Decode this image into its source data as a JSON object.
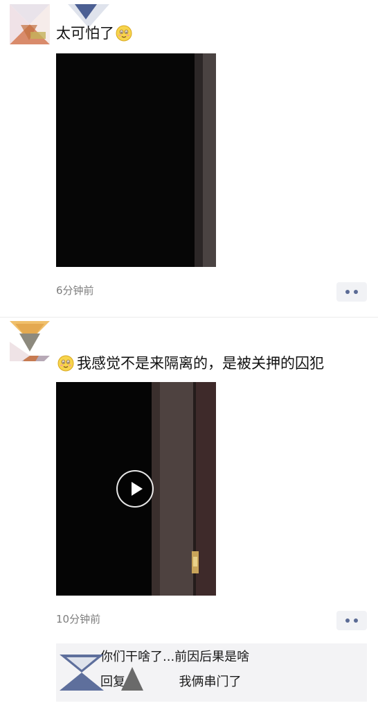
{
  "posts": [
    {
      "text": "太可怕了",
      "emoji_position": "end",
      "emoji": "smiling-face-emoji",
      "media": "photo",
      "time": "6分钟前"
    },
    {
      "text": "我感觉不是来隔离的，是被关押的囚犯",
      "emoji_position": "start",
      "emoji": "smiling-face-emoji",
      "media": "video",
      "time": "10分钟前",
      "comments": [
        {
          "text": "你们干啥了...前因后果是啥"
        },
        {
          "reply_label": "回复",
          "text": "我俩串门了"
        }
      ]
    }
  ],
  "colors": {
    "link": "#576b95",
    "time": "#7d7d7d",
    "comment_bg": "#f3f3f5",
    "more_button_bg": "#f1f2f5"
  }
}
